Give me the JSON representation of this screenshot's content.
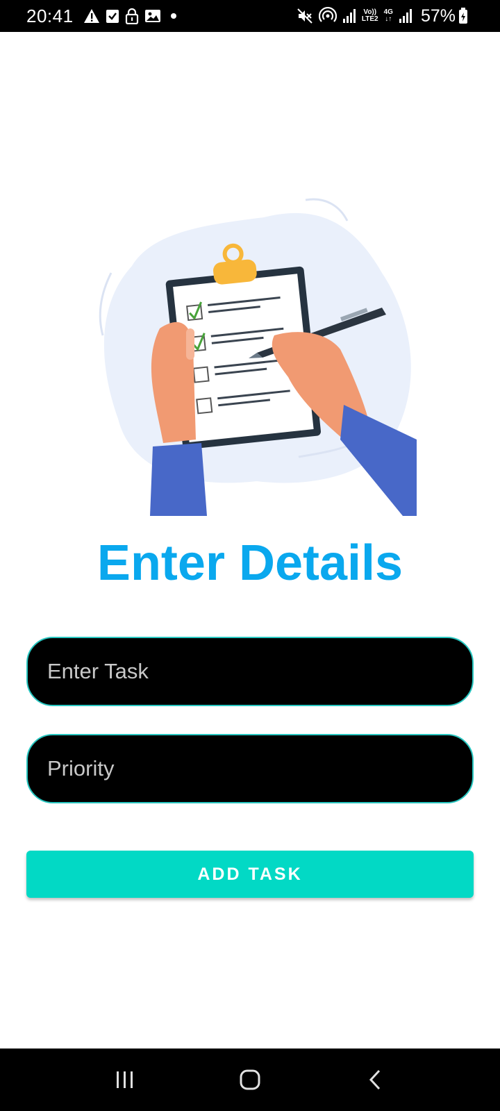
{
  "status_bar": {
    "time": "20:41",
    "battery_percent": "57%",
    "network_type": "4G",
    "volte_label_top": "Vo))",
    "volte_label_bottom": "LTE2",
    "icons": [
      "warning-icon",
      "check-box-icon",
      "lock-icon",
      "image-icon",
      "notification-dot",
      "mute-icon",
      "hotspot-icon",
      "signal-icon",
      "volte-icon",
      "network-4g-icon",
      "signal-icon",
      "battery-icon"
    ]
  },
  "illustration": {
    "name": "clipboard-checklist-illustration"
  },
  "page": {
    "title": "Enter Details"
  },
  "form": {
    "task_placeholder": "Enter Task",
    "task_value": "",
    "priority_placeholder": "Priority",
    "priority_value": "",
    "submit_label": "ADD TASK"
  },
  "colors": {
    "title": "#0aa8ee",
    "field_border": "#27c6c0",
    "button": "#02d9c5"
  },
  "nav_bar": {
    "icons": [
      "recent-apps-icon",
      "home-icon",
      "back-icon"
    ]
  }
}
